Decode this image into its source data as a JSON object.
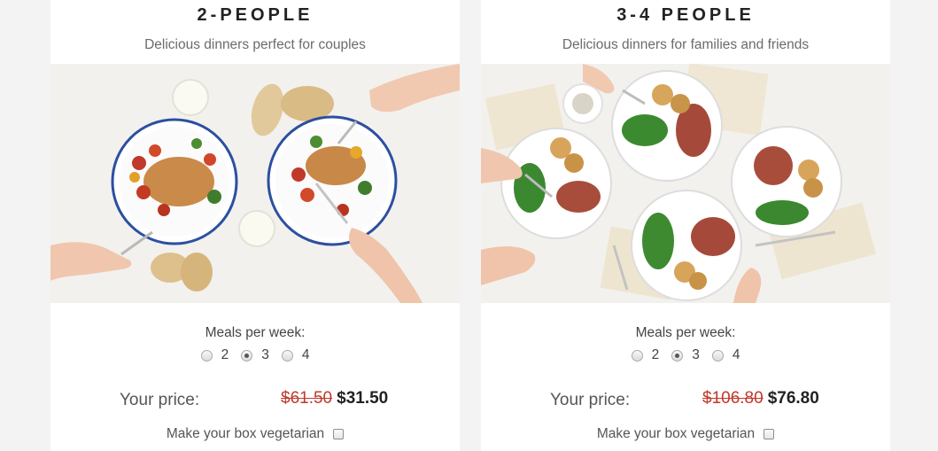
{
  "plans": [
    {
      "title": "2-PEOPLE",
      "subtitle": "Delicious dinners perfect for couples",
      "photo_icon": "pork-chop-dinner-photo",
      "meals_label": "Meals per week:",
      "meal_options": [
        "2",
        "3",
        "4"
      ],
      "selected_meals": "3",
      "price_label": "Your price:",
      "old_price": "$61.50",
      "new_price": "$31.50",
      "vegetarian_label": "Make your box vegetarian",
      "vegetarian_checked": false
    },
    {
      "title": "3-4 PEOPLE",
      "subtitle": "Delicious dinners for families and friends",
      "photo_icon": "steak-green-beans-dinner-photo",
      "meals_label": "Meals per week:",
      "meal_options": [
        "2",
        "3",
        "4"
      ],
      "selected_meals": "3",
      "price_label": "Your price:",
      "old_price": "$106.80",
      "new_price": "$76.80",
      "vegetarian_label": "Make your box vegetarian",
      "vegetarian_checked": false
    }
  ],
  "colors": {
    "background": "#f3f3f3",
    "card": "#ffffff",
    "old_price": "#c0392b",
    "plate_rim": "#2c4fa0"
  }
}
